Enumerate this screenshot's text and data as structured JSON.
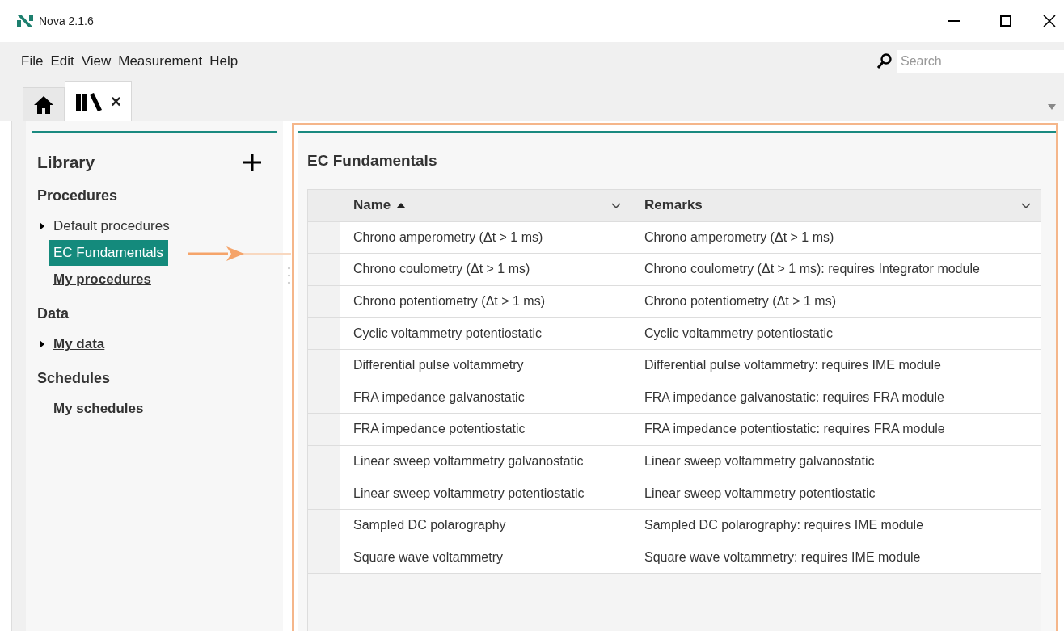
{
  "window": {
    "title": "Nova 2.1.6"
  },
  "menu": [
    "File",
    "Edit",
    "View",
    "Measurement",
    "Help"
  ],
  "search": {
    "placeholder": "Search"
  },
  "tabs": [
    {
      "kind": "home",
      "selected": false
    },
    {
      "kind": "library",
      "selected": true,
      "close": "×"
    }
  ],
  "sidebar": {
    "title": "Library",
    "sections": [
      {
        "title": "Procedures",
        "items": [
          {
            "label": "Default procedures",
            "kind": "item",
            "expanded": false,
            "selected": false
          },
          {
            "label": "EC Fundamentals",
            "kind": "item",
            "selected": true
          },
          {
            "label": "My procedures",
            "kind": "link",
            "selected": false
          }
        ]
      },
      {
        "title": "Data",
        "items": [
          {
            "label": "My data",
            "kind": "link",
            "expanded": false,
            "selected": false
          }
        ]
      },
      {
        "title": "Schedules",
        "items": [
          {
            "label": "My schedules",
            "kind": "link",
            "selected": false
          }
        ]
      }
    ]
  },
  "main": {
    "title": "EC Fundamentals",
    "table": {
      "columns": [
        {
          "label": "Name",
          "sorted": true
        },
        {
          "label": "Remarks"
        }
      ],
      "rows": [
        [
          "Chrono amperometry (Δt > 1 ms)",
          "Chrono amperometry (Δt > 1 ms)"
        ],
        [
          "Chrono coulometry (Δt > 1 ms)",
          "Chrono coulometry (Δt > 1 ms): requires Integrator module"
        ],
        [
          "Chrono potentiometry (Δt > 1 ms)",
          "Chrono potentiometry (Δt > 1 ms)"
        ],
        [
          "Cyclic voltammetry potentiostatic",
          "Cyclic voltammetry potentiostatic"
        ],
        [
          "Differential pulse voltammetry",
          "Differential pulse voltammetry: requires IME module"
        ],
        [
          "FRA impedance galvanostatic",
          "FRA impedance galvanostatic: requires FRA module"
        ],
        [
          "FRA impedance potentiostatic",
          "FRA impedance potentiostatic: requires FRA module"
        ],
        [
          "Linear sweep voltammetry galvanostatic",
          "Linear sweep voltammetry galvanostatic"
        ],
        [
          "Linear sweep voltammetry potentiostatic",
          "Linear sweep voltammetry potentiostatic"
        ],
        [
          "Sampled DC polarography",
          "Sampled DC polarography: requires IME module"
        ],
        [
          "Square wave voltammetry",
          "Square wave voltammetry: requires IME module"
        ]
      ]
    }
  }
}
